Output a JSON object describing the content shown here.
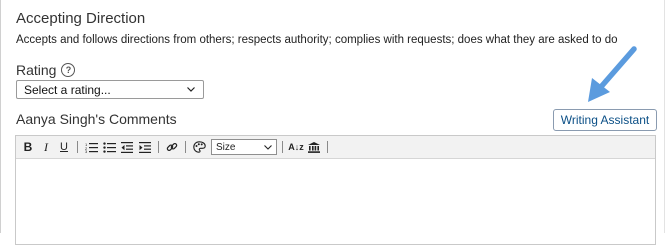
{
  "section": {
    "title": "Accepting Direction",
    "description": "Accepts and follows directions from others; respects authority; complies with requests; does what they are asked to do"
  },
  "rating": {
    "label": "Rating",
    "selected": "Select a rating..."
  },
  "comments": {
    "label": "Aanya Singh's Comments"
  },
  "writing_assistant": {
    "label": "Writing Assistant"
  },
  "toolbar": {
    "bold": "B",
    "italic": "I",
    "underline": "U",
    "size_selected": "Size",
    "font_size_glyph": "A↓z"
  },
  "colors": {
    "arrow": "#5b9bde",
    "button_text": "#0b4f86"
  }
}
